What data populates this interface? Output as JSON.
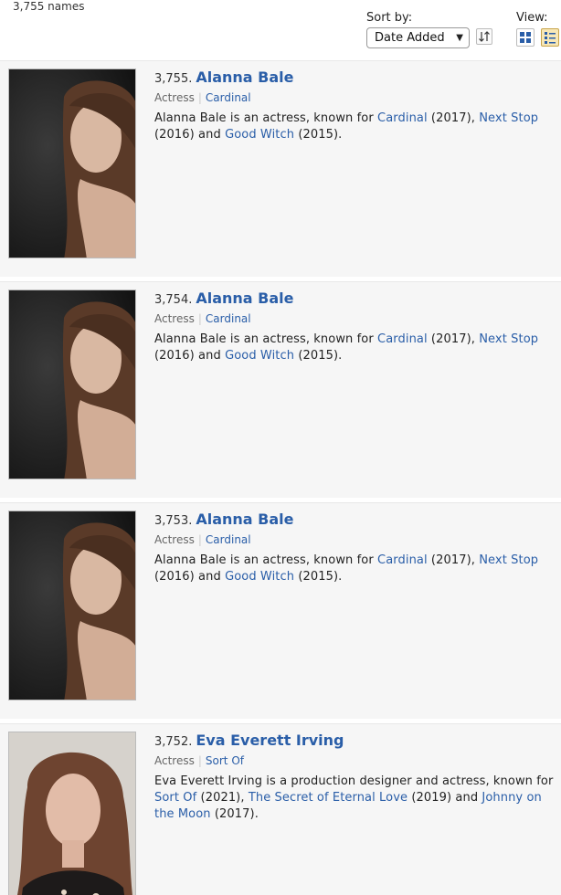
{
  "header": {
    "count": "3,755 names",
    "sort_label": "Sort by:",
    "sort_value": "Date Added",
    "view_label": "View:"
  },
  "icons": {
    "sort_toggle": "sort-direction-icon",
    "grid_view": "grid-view-icon",
    "list_view": "list-view-icon"
  },
  "items": [
    {
      "number": "3,755.",
      "name": "Alanna Bale",
      "role": "Actress",
      "known_for": "Cardinal",
      "bio": {
        "t1": "Alanna Bale is an actress, known for ",
        "l1": "Cardinal",
        "t2": " (2017), ",
        "l2": "Next Stop",
        "t3": " (2016) and ",
        "l3": "Good Witch",
        "t4": " (2015)."
      }
    },
    {
      "number": "3,754.",
      "name": "Alanna Bale",
      "role": "Actress",
      "known_for": "Cardinal",
      "bio": {
        "t1": "Alanna Bale is an actress, known for ",
        "l1": "Cardinal",
        "t2": " (2017), ",
        "l2": "Next Stop",
        "t3": " (2016) and ",
        "l3": "Good Witch",
        "t4": " (2015)."
      }
    },
    {
      "number": "3,753.",
      "name": "Alanna Bale",
      "role": "Actress",
      "known_for": "Cardinal",
      "bio": {
        "t1": "Alanna Bale is an actress, known for ",
        "l1": "Cardinal",
        "t2": " (2017), ",
        "l2": "Next Stop",
        "t3": " (2016) and ",
        "l3": "Good Witch",
        "t4": " (2015)."
      }
    },
    {
      "number": "3,752.",
      "name": "Eva Everett Irving",
      "role": "Actress",
      "known_for": "Sort Of",
      "bio": {
        "t1": "Eva Everett Irving is a production designer and actress, known for ",
        "l1": "Sort Of",
        "t2": " (2021), ",
        "l2": "The Secret of Eternal Love",
        "t3": " (2019) and ",
        "l3": "Johnny on the Moon",
        "t4": " (2017)."
      }
    }
  ]
}
